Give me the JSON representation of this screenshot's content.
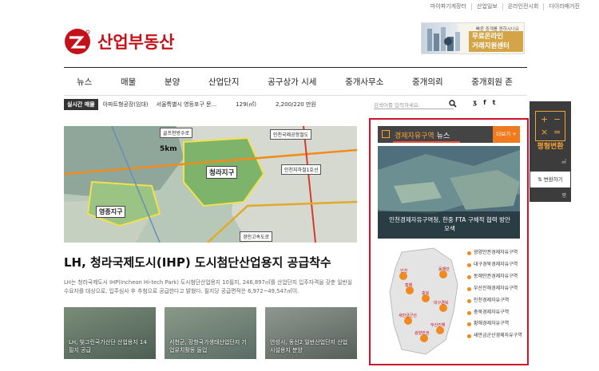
{
  "topbar": {
    "links": [
      "마이파기게장터",
      "산업일보",
      "온라인전시회",
      "다이라매거진"
    ]
  },
  "logo": {
    "text": "산업부동산",
    "icon": "logo-emblem",
    "brand_color": "#c4121a"
  },
  "ad": {
    "top_text": "빠른 중개를 원하시나요",
    "lines": [
      "무료온라인",
      "거래지원센터"
    ],
    "accent": "#d4a546"
  },
  "nav": {
    "items": [
      "뉴스",
      "매물",
      "분양",
      "산업단지",
      "공구상가 시세",
      "중개사무소",
      "중개의뢰",
      "중개회원 존"
    ]
  },
  "realtime": {
    "badge": "실시간 매물",
    "items": [
      "아파트형공장(임대)",
      "서울특별시 영등포구 문...",
      "129(㎡)",
      "2,200/220 만원"
    ],
    "search_placeholder": "검색어를 입력하세요.",
    "social": [
      "ʒ",
      "f",
      "t"
    ]
  },
  "hero": {
    "map_labels": {
      "bridge": "골프천방수로",
      "rail": "인천국제공항철도",
      "distance": "5km",
      "center": "청라지구",
      "west": "영종지구",
      "subway": "인천지하철1호선",
      "highway": "경인고속도로"
    },
    "title": "LH, 청라국제도시(IHP) 도시첨단산업용지 공급착수",
    "desc": "LH는 청라국제도시 IHP(Incheon Hi-tech Park) 도시첨단산업용지 10필지, 246,897㎡를 산업단지 입주자격을 갖춘 일반실수요자를 대상으로, 입주심사 후 추첨으로 공급한다고 밝혔다. 필지당 공급면적은 6,972~49,547㎡이."
  },
  "thumbs": [
    {
      "caption": "LH, 빛그린국가산단 산업용지 14필지 공급"
    },
    {
      "caption": "서천군, 장항국가생태산업단지 기업유치활동 돌입"
    },
    {
      "caption": "안성시, 동신2 일반산업단지 산업시설용지 분양"
    }
  ],
  "panel": {
    "title": "경제자유구역",
    "subtitle": "뉴스",
    "more": "더보기 +",
    "image_caption": "인천경제자유구역청, 한중 FTA 구체적 협력 방안 모색",
    "zones": [
      "광양만권경제자유구역",
      "대구경북경제자유구역",
      "동해안권경제자유구역",
      "부산진해경제자유구역",
      "인천경제자유구역",
      "충북경제자유구역",
      "황해경제자유구역",
      "새만금군산경제자유구역"
    ],
    "map_labels": [
      "인천",
      "동해안",
      "황해",
      "충북",
      "대구경북",
      "새만금군산",
      "부산진해",
      "광양만권"
    ],
    "accent": "#d0102a"
  },
  "tool": {
    "label": "평형변환",
    "unit_top": "㎡",
    "convert": "변환하기",
    "unit_bottom": "평"
  }
}
